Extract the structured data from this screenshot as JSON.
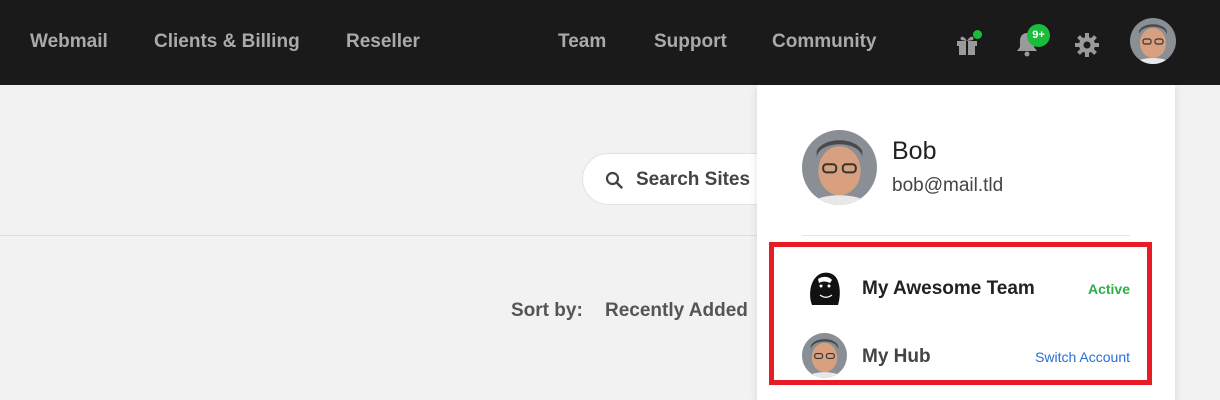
{
  "nav": {
    "left": [
      "Webmail",
      "Clients & Billing",
      "Reseller"
    ],
    "right": [
      "Team",
      "Support",
      "Community"
    ],
    "icons": [
      "gift-icon",
      "bell-icon",
      "gear-icon"
    ],
    "notification_badge": "9+",
    "colors": {
      "bar": "#1a1a1a",
      "link": "#aaaaaa",
      "badge": "#1abc3c"
    }
  },
  "search": {
    "label": "Search Sites",
    "icon": "search-icon"
  },
  "sort": {
    "label": "Sort by:",
    "value": "Recently Added"
  },
  "profile_menu": {
    "name": "Bob",
    "email": "bob@mail.tld",
    "accounts": [
      {
        "name": "My Awesome Team",
        "status": "Active",
        "avatar": "gorilla-logo"
      },
      {
        "name": "My Hub",
        "action": "Switch Account",
        "avatar": "user-photo"
      }
    ],
    "colors": {
      "highlight": "#e81c24",
      "active": "#2fae4a",
      "link": "#2a6fd6"
    }
  }
}
